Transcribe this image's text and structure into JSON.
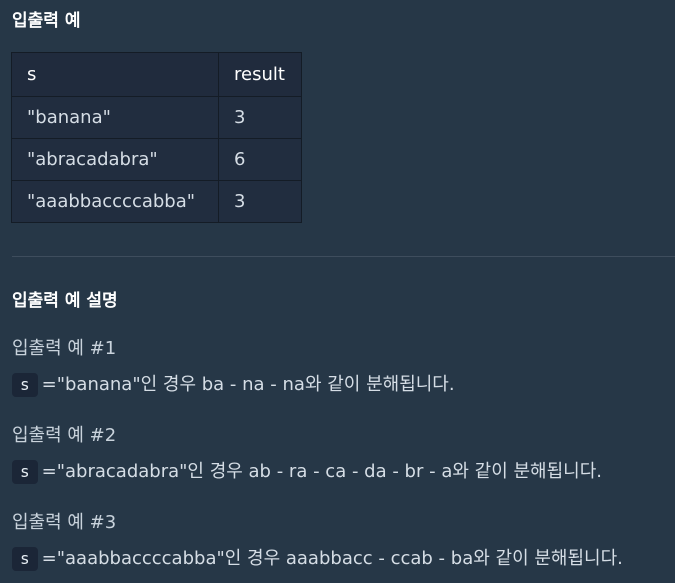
{
  "examples": {
    "title": "입출력 예",
    "columns": [
      "s",
      "result"
    ],
    "rows": [
      {
        "s": "\"banana\"",
        "result": "3"
      },
      {
        "s": "\"abracadabra\"",
        "result": "6"
      },
      {
        "s": "\"aaabbaccccabba\"",
        "result": "3"
      }
    ]
  },
  "explanation": {
    "title": "입출력 예 설명",
    "cases": [
      {
        "heading": "입출력 예 #1",
        "code": "s",
        "text": "=\"banana\"인 경우 ba - na - na와 같이 분해됩니다."
      },
      {
        "heading": "입출력 예 #2",
        "code": "s",
        "text": "=\"abracadabra\"인 경우 ab - ra - ca - da - br - a와 같이 분해됩니다."
      },
      {
        "heading": "입출력 예 #3",
        "code": "s",
        "text": "=\"aaabbaccccabba\"인 경우 aaabbacc - ccab - ba와 같이 분해됩니다."
      }
    ]
  }
}
